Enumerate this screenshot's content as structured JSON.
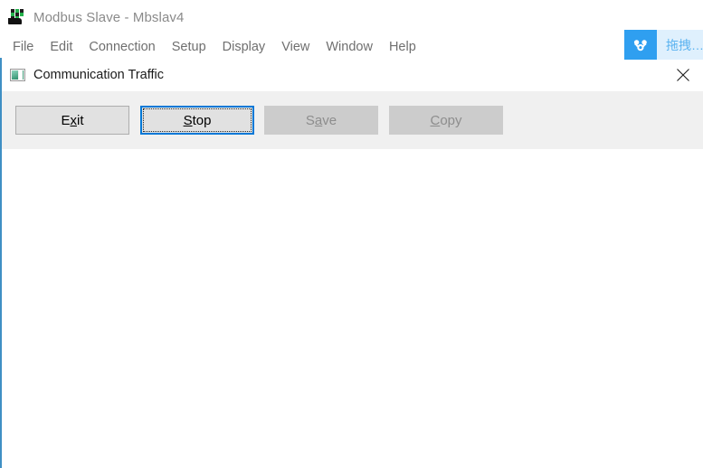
{
  "app_window": {
    "title": "Modbus Slave - Mbslav4",
    "icon": "modbus-slave-icon",
    "menu": [
      {
        "label": "File"
      },
      {
        "label": "Edit"
      },
      {
        "label": "Connection"
      },
      {
        "label": "Setup"
      },
      {
        "label": "Display"
      },
      {
        "label": "View"
      },
      {
        "label": "Window"
      },
      {
        "label": "Help"
      }
    ]
  },
  "netdisk_badge": {
    "icon": "baidu-netdisk-icon",
    "text": "拖拽…",
    "button_color": "#2f9ff0",
    "panel_color": "#dff0fd",
    "text_color": "#5bb3f0"
  },
  "child_window": {
    "title": "Communication Traffic",
    "icon": "window-pane-icon",
    "close_icon": "close-icon",
    "toolbar": {
      "buttons": [
        {
          "name": "exit",
          "label_before": "E",
          "label_accel": "x",
          "label_after": "it",
          "state": "enabled"
        },
        {
          "name": "stop",
          "label_before": "",
          "label_accel": "S",
          "label_after": "top",
          "state": "focused"
        },
        {
          "name": "save",
          "label_before": "S",
          "label_accel": "a",
          "label_after": "ve",
          "state": "disabled"
        },
        {
          "name": "copy",
          "label_before": "",
          "label_accel": "C",
          "label_after": "opy",
          "state": "disabled"
        }
      ]
    },
    "log": {
      "lines": [],
      "empty_text": ""
    }
  },
  "colors": {
    "accent_blue": "#0078d7",
    "window_border_blue": "#3f8fc4",
    "toolbar_gray": "#f0f0f0",
    "button_face": "#e1e1e1",
    "button_disabled": "#cccccc"
  }
}
